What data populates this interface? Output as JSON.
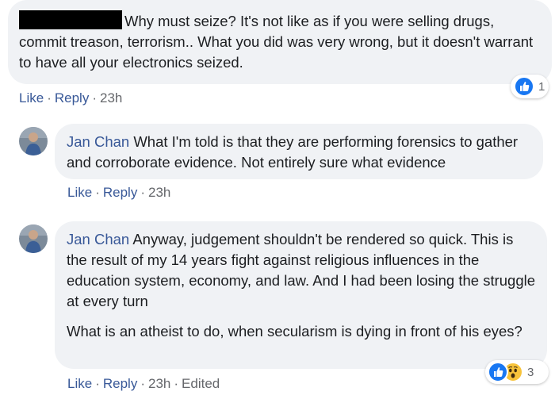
{
  "comments": [
    {
      "text": "Why must seize? It's not like as if you were selling drugs, commit treason, terrorism.. What you did was very wrong, but it doesn't warrant to have all your electronics seized.",
      "actions": {
        "like": "Like",
        "reply": "Reply",
        "time": "23h"
      },
      "reactions": {
        "count": "1",
        "icons": [
          "like-icon"
        ]
      },
      "colors": {
        "link": "#385898",
        "bubble": "#f0f2f5"
      }
    },
    {
      "author": "Jan Chan",
      "text": "What I'm told is that they are performing forensics to gather and corroborate evidence. Not entirely sure what evidence",
      "actions": {
        "like": "Like",
        "reply": "Reply",
        "time": "23h"
      }
    },
    {
      "author": "Jan Chan",
      "paragraphs": [
        "Anyway, judgement shouldn't be rendered so quick. This is the result of my 14 years fight against religious influences in the education system, economy, and law. And I had been losing the struggle at every turn",
        "What is an atheist to do, when secularism is dying in front of his eyes?"
      ],
      "actions": {
        "like": "Like",
        "reply": "Reply",
        "time": "23h",
        "edited": "Edited"
      },
      "reactions": {
        "count": "3",
        "icons": [
          "like-icon",
          "wow-icon"
        ]
      }
    }
  ],
  "separator": "·"
}
